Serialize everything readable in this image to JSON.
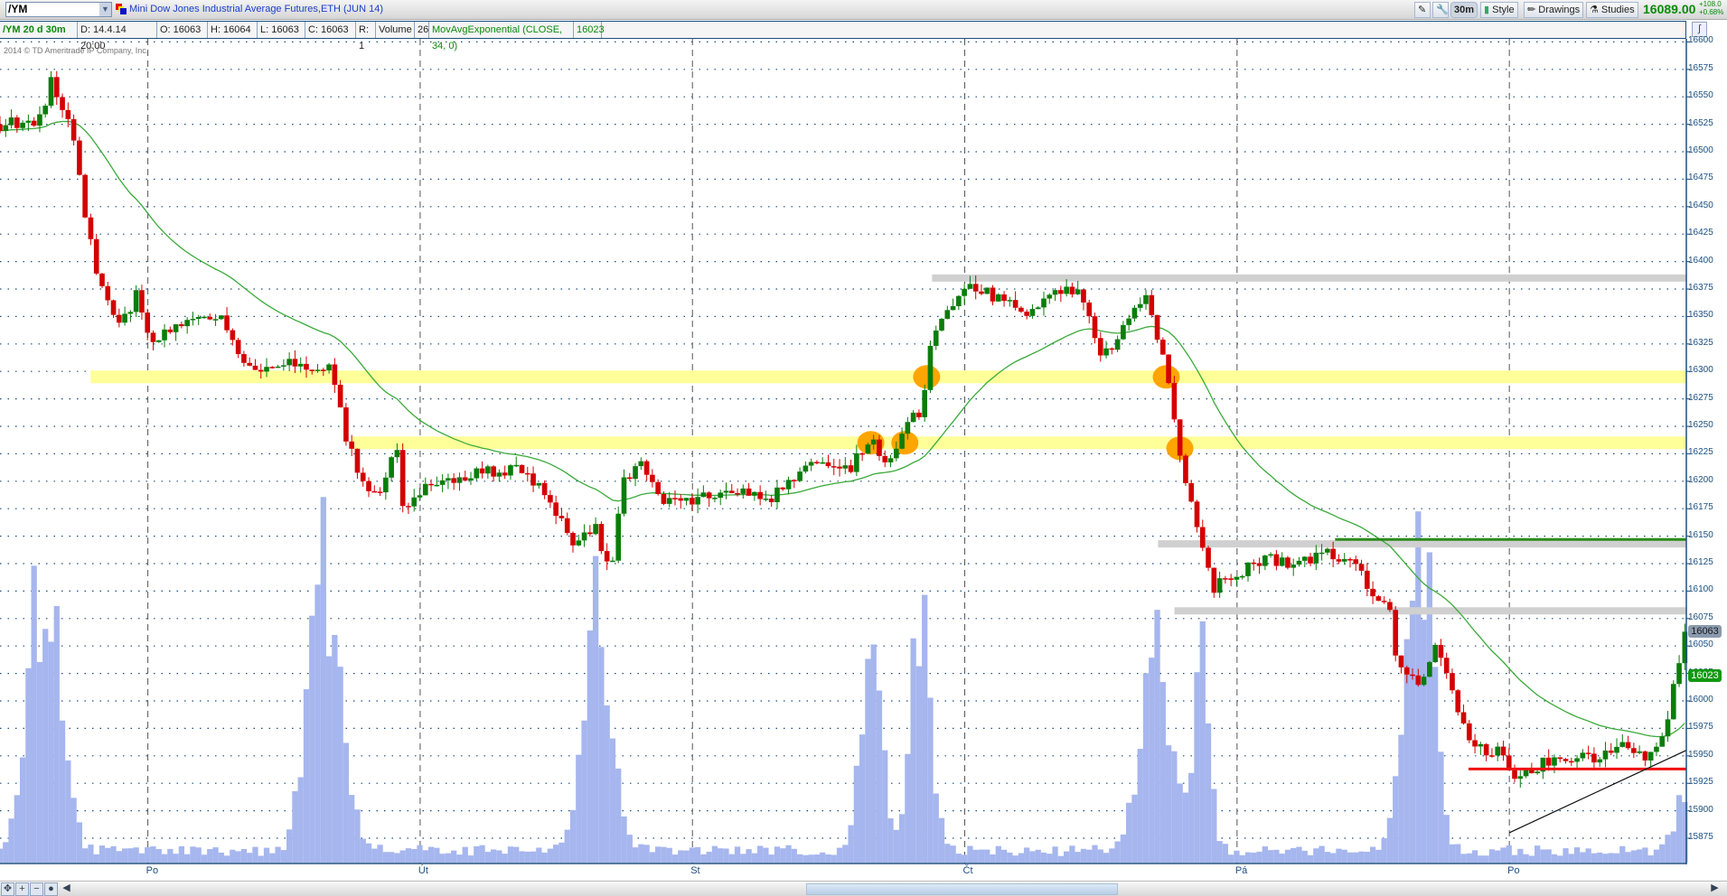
{
  "toolbar": {
    "symbol": "/YM",
    "title": "Mini Dow Jones Industrial Average Futures,ETH (JUN 14)",
    "interval": "30m",
    "style": "Style",
    "drawings": "Drawings",
    "studies": "Studies",
    "last_price": "16089.00",
    "change_abs": "+108.0",
    "change_pct": "+0.68%"
  },
  "infobar": {
    "series": "/YM 20 d 30m",
    "date": "D: 14.4.14 20:00",
    "open": "O: 16063",
    "high": "H: 16064",
    "low": "L: 16063",
    "close": "C: 16063",
    "range": "R: 1",
    "volume_label": "Volume",
    "volume_value": "26",
    "study": "MovAvgExponential (CLOSE, 34, 0)",
    "study_value": "16023"
  },
  "copyright": "2014 © TD Ameritrade IP Company, Inc.",
  "colors": {
    "up": "#0a7d0a",
    "down": "#d40000",
    "ema": "#3aaa3a",
    "volume": "#a6b6ee",
    "grid": "#1d4f7e",
    "band": "#ffff99",
    "gray": "#d0d0d0",
    "orange": "#ffa500"
  },
  "chart_data": {
    "type": "candlestick",
    "title": "/YM 20 d 30m",
    "ylim": [
      15855,
      16610
    ],
    "yticks": [
      16600,
      16575,
      16550,
      16525,
      16500,
      16475,
      16450,
      16425,
      16400,
      16375,
      16350,
      16325,
      16300,
      16275,
      16250,
      16225,
      16200,
      16175,
      16150,
      16125,
      16100,
      16075,
      16050,
      16025,
      16000,
      15975,
      15950,
      15925,
      15900,
      15875
    ],
    "xlim_days": [
      0.457,
      6.65
    ],
    "bars_per_day": 48,
    "day_labels": [
      {
        "t": 1,
        "label": "Po"
      },
      {
        "t": 2,
        "label": "Út"
      },
      {
        "t": 3,
        "label": "St"
      },
      {
        "t": 4,
        "label": "Čt"
      },
      {
        "t": 5,
        "label": "Pá"
      },
      {
        "t": 6,
        "label": "Po"
      }
    ],
    "close_path": [
      [
        0.457,
        16525
      ],
      [
        0.62,
        16530
      ],
      [
        0.64,
        16570
      ],
      [
        0.72,
        16520
      ],
      [
        0.76,
        16460
      ],
      [
        0.8,
        16400
      ],
      [
        0.86,
        16360
      ],
      [
        0.9,
        16340
      ],
      [
        0.96,
        16370
      ],
      [
        1.0,
        16330
      ],
      [
        1.11,
        16340
      ],
      [
        1.19,
        16350
      ],
      [
        1.27,
        16345
      ],
      [
        1.33,
        16320
      ],
      [
        1.41,
        16295
      ],
      [
        1.51,
        16310
      ],
      [
        1.59,
        16300
      ],
      [
        1.67,
        16310
      ],
      [
        1.69,
        16280
      ],
      [
        1.73,
        16240
      ],
      [
        1.79,
        16200
      ],
      [
        1.85,
        16190
      ],
      [
        1.915,
        16230
      ],
      [
        1.935,
        16175
      ],
      [
        1.995,
        16190
      ],
      [
        2.08,
        16200
      ],
      [
        2.16,
        16200
      ],
      [
        2.24,
        16210
      ],
      [
        2.36,
        16210
      ],
      [
        2.44,
        16195
      ],
      [
        2.5,
        16170
      ],
      [
        2.56,
        16145
      ],
      [
        2.64,
        16160
      ],
      [
        2.7,
        16110
      ],
      [
        2.745,
        16200
      ],
      [
        2.805,
        16220
      ],
      [
        2.89,
        16180
      ],
      [
        2.97,
        16180
      ],
      [
        3.05,
        16185
      ],
      [
        3.13,
        16190
      ],
      [
        3.29,
        16185
      ],
      [
        3.45,
        16215
      ],
      [
        3.575,
        16210
      ],
      [
        3.655,
        16240
      ],
      [
        3.72,
        16210
      ],
      [
        3.78,
        16250
      ],
      [
        3.84,
        16265
      ],
      [
        3.88,
        16330
      ],
      [
        3.94,
        16360
      ],
      [
        4.02,
        16375
      ],
      [
        4.1,
        16370
      ],
      [
        4.18,
        16360
      ],
      [
        4.24,
        16350
      ],
      [
        4.32,
        16370
      ],
      [
        4.405,
        16375
      ],
      [
        4.445,
        16360
      ],
      [
        4.485,
        16320
      ],
      [
        4.53,
        16315
      ],
      [
        4.59,
        16340
      ],
      [
        4.67,
        16375
      ],
      [
        4.71,
        16330
      ],
      [
        4.75,
        16285
      ],
      [
        4.79,
        16225
      ],
      [
        4.83,
        16180
      ],
      [
        4.87,
        16150
      ],
      [
        4.91,
        16100
      ],
      [
        4.95,
        16110
      ],
      [
        5.03,
        16120
      ],
      [
        5.11,
        16130
      ],
      [
        5.235,
        16125
      ],
      [
        5.355,
        16135
      ],
      [
        5.44,
        16120
      ],
      [
        5.56,
        16080
      ],
      [
        5.58,
        16040
      ],
      [
        5.64,
        16020
      ],
      [
        5.68,
        16010
      ],
      [
        5.72,
        16050
      ],
      [
        5.76,
        16030
      ],
      [
        5.8,
        16000
      ],
      [
        5.86,
        15960
      ],
      [
        5.9,
        15955
      ],
      [
        5.965,
        15955
      ],
      [
        6.025,
        15925
      ],
      [
        6.085,
        15940
      ],
      [
        6.21,
        15950
      ],
      [
        6.33,
        15945
      ],
      [
        6.41,
        15965
      ],
      [
        6.49,
        15945
      ],
      [
        6.57,
        15975
      ],
      [
        6.65,
        16063
      ]
    ],
    "volume_bumps": [
      [
        0.62,
        300,
        0.08
      ],
      [
        1.65,
        300,
        0.08
      ],
      [
        2.65,
        260,
        0.07
      ],
      [
        3.66,
        250,
        0.05
      ],
      [
        3.84,
        240,
        0.05
      ],
      [
        4.7,
        200,
        0.08
      ],
      [
        4.87,
        200,
        0.04
      ],
      [
        5.65,
        290,
        0.06
      ],
      [
        5.72,
        180,
        0.04
      ],
      [
        6.63,
        50,
        0.04
      ]
    ],
    "volume_max": 320,
    "ema_period": 34,
    "last_label": "16063",
    "ema_label": "16023",
    "annotations": {
      "bands": [
        {
          "price": 16295,
          "from": 0.79,
          "color": "yellow"
        },
        {
          "price": 16235,
          "from": 1.75,
          "color": "yellow"
        }
      ],
      "gray_lines": [
        {
          "price": 16385,
          "from": 3.88
        },
        {
          "price": 16143,
          "from": 4.71
        },
        {
          "price": 16082,
          "from": 4.77
        }
      ],
      "green_line": {
        "price": 16147,
        "from": 5.36
      },
      "red_line": {
        "price": 15938,
        "from": 5.85
      },
      "trendline": [
        [
          6.0,
          15880
        ],
        [
          6.65,
          15955
        ]
      ],
      "circles": [
        [
          3.86,
          16295
        ],
        [
          4.74,
          16295
        ],
        [
          3.655,
          16235
        ],
        [
          3.78,
          16235
        ],
        [
          4.79,
          16230
        ]
      ]
    }
  }
}
